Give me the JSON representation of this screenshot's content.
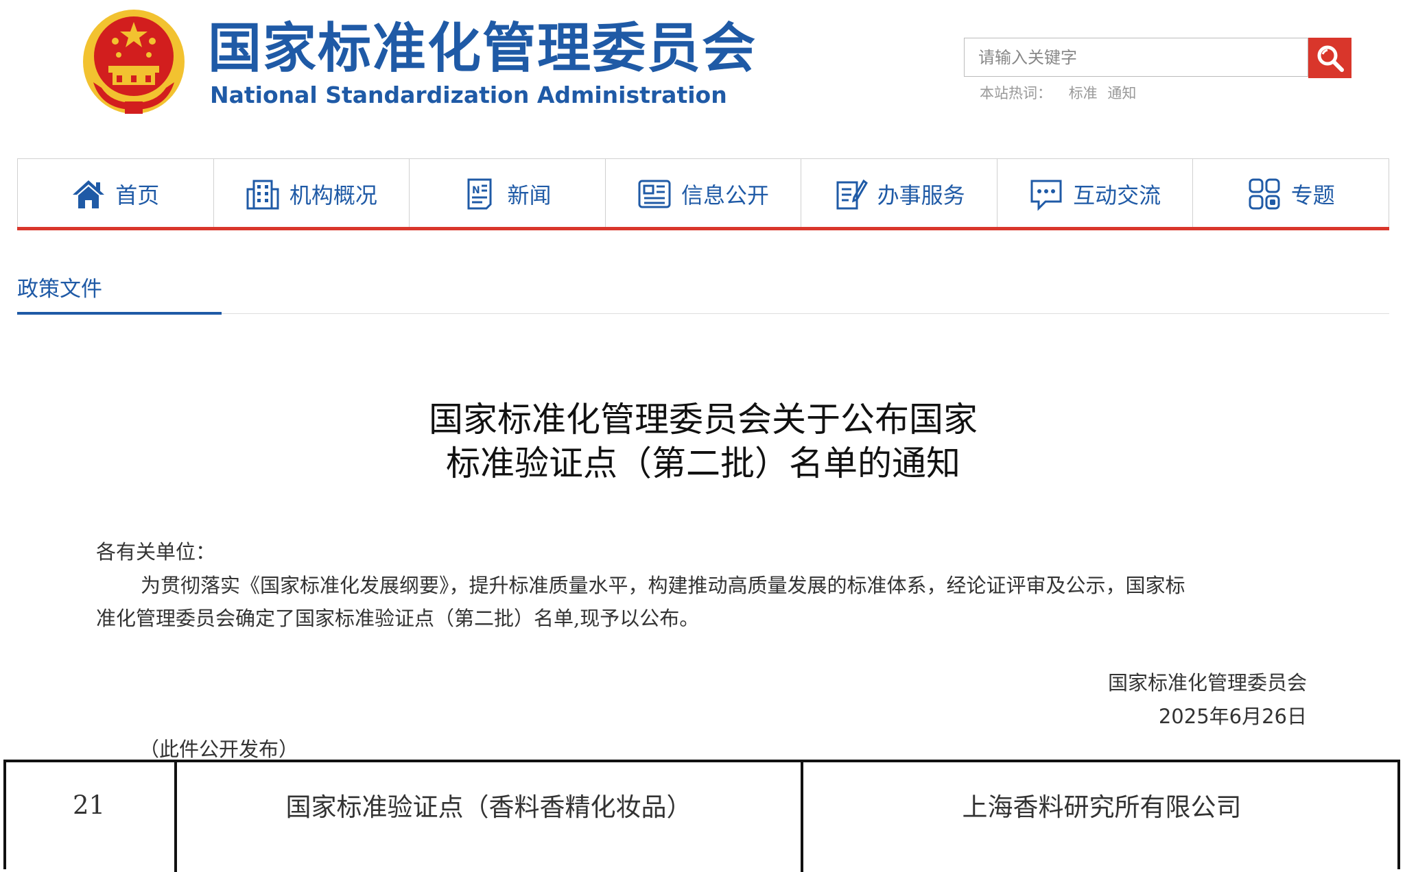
{
  "header": {
    "title_cn": "国家标准化管理委员会",
    "title_en": "National Standardization Administration",
    "search_placeholder": "请输入关键字",
    "hot_words_label": "本站热词：",
    "hot_words": [
      "标准",
      "通知"
    ]
  },
  "nav": {
    "items": [
      {
        "label": "首页",
        "icon": "home-icon"
      },
      {
        "label": "机构概况",
        "icon": "building-icon"
      },
      {
        "label": "新闻",
        "icon": "news-icon"
      },
      {
        "label": "信息公开",
        "icon": "info-icon"
      },
      {
        "label": "办事服务",
        "icon": "service-icon"
      },
      {
        "label": "互动交流",
        "icon": "chat-icon"
      },
      {
        "label": "专题",
        "icon": "grid-icon"
      }
    ]
  },
  "section": {
    "tab": "政策文件"
  },
  "article": {
    "title_line1": "国家标准化管理委员会关于公布国家",
    "title_line2": "标准验证点（第二批）名单的通知",
    "salutation": "各有关单位：",
    "para_line1": "为贯彻落实《国家标准化发展纲要》，提升标准质量水平，构建推动高质量发展的标准体系，经论证评审及公示，国家标",
    "para_line2": "准化管理委员会确定了国家标准验证点（第二批）名单,现予以公布。",
    "sign_org": "国家标准化管理委员会",
    "sign_date": "2025年6月26日",
    "public_note": "（此件公开发布）"
  },
  "table": {
    "rows": [
      {
        "no": "21",
        "name": "国家标准验证点（香料香精化妆品）",
        "org": "上海香料研究所有限公司"
      }
    ]
  },
  "colors": {
    "brand_blue": "#1f5aa6",
    "accent_red": "#d9362b",
    "emblem_gold": "#f2c230"
  }
}
